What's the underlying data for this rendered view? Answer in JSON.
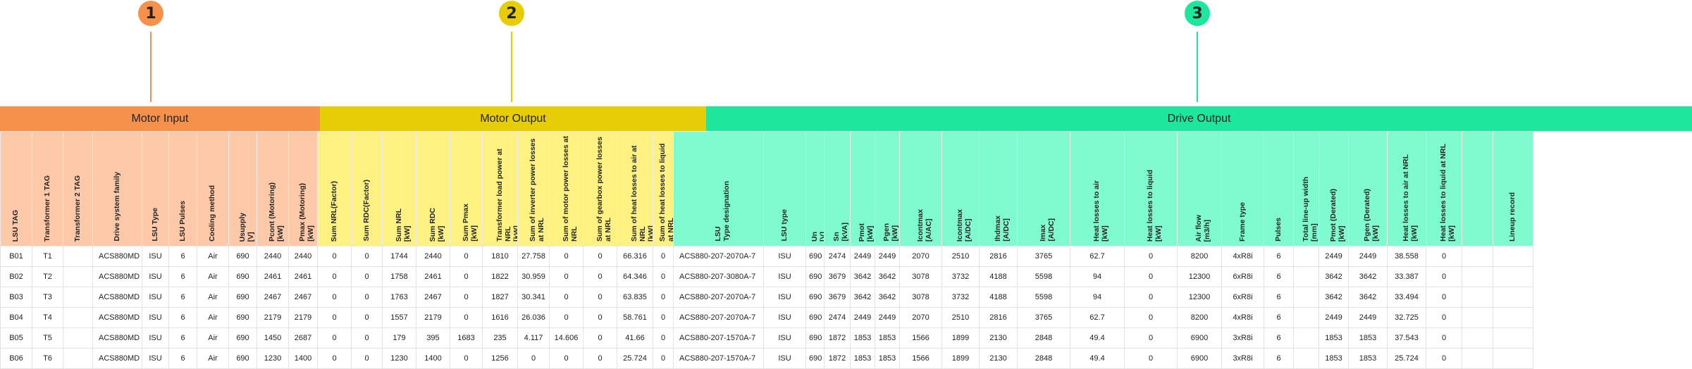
{
  "colors": {
    "motor_input_header": "#f5914a",
    "motor_input_columns": "#fdc9a8",
    "motor_output_header": "#e7cd05",
    "motor_output_columns": "#fdf281",
    "drive_output_header": "#1ee69c",
    "drive_output_columns": "#7efccf"
  },
  "callouts": [
    {
      "label": "1",
      "color": "#f5914a"
    },
    {
      "label": "2",
      "color": "#e7cd05"
    },
    {
      "label": "3",
      "color": "#1ee69c"
    }
  ],
  "sections": {
    "motor_input": "Motor Input",
    "motor_output": "Motor Output",
    "drive_output": "Drive Output"
  },
  "columns": [
    "LSU TAG",
    "Transformer 1 TAG",
    "Transformer 2 TAG",
    "Drive system family",
    "LSU Type",
    "LSU Pulses",
    "Cooling method",
    "Usupply\n[V]",
    "Pcont (Motoring)\n[kW]",
    "Pmax (Motoring)\n[kW]",
    "Sum NRL(Factor)",
    "Sum RDC(Factor)",
    "Sum NRL\n[kW]",
    "Sum RDC\n[kW]",
    "Sum Pmax\n[kW]",
    "Transformer load power at NRL\n[kW]",
    "Sum of inverter power losses at NRL",
    "Sum of motor power losses at NRL",
    "Sum of gearbox power losses at NRL",
    "Sum of heat losses to air at NRL\n[kW]",
    "Sum of heat losses to liquid at NRL",
    "LSU\nType designation",
    "LSU type",
    "Un\n[V]",
    "Sn\n[kVA]",
    "Pmot\n[kW]",
    "Pgen\n[kW]",
    "Icontmax\n[A/AC]",
    "Icontmax\n[A/DC]",
    "Ihdmax\n[A/DC]",
    "Imax\n[A/DC]",
    "Heat losses to air\n[kW]",
    "Heat losses to liquid\n[kW]",
    "Air flow\n[m3/h]",
    "Frame type",
    "Pulses",
    "Total line-up width\n[mm]",
    "Pmot (Derated)\n[kW]",
    "Pgen (Derated)\n[kW]",
    "Heat losses to air at NRL\n[kW]",
    "Heat losses to liquid at NRL\n[kW]",
    "",
    "Lineup record"
  ],
  "rows": [
    [
      "B01",
      "T1",
      "",
      "ACS880MD",
      "ISU",
      "6",
      "Air",
      "690",
      "2440",
      "2440",
      "0",
      "0",
      "1744",
      "2440",
      "0",
      "1810",
      "27.758",
      "0",
      "0",
      "66.316",
      "0",
      "ACS880-207-2070A-7",
      "ISU",
      "690",
      "2474",
      "2449",
      "2449",
      "2070",
      "2510",
      "2816",
      "3765",
      "62.7",
      "0",
      "8200",
      "4xR8i",
      "6",
      "",
      "2449",
      "2449",
      "38.558",
      "0",
      "",
      ""
    ],
    [
      "B02",
      "T2",
      "",
      "ACS880MD",
      "ISU",
      "6",
      "Air",
      "690",
      "2461",
      "2461",
      "0",
      "0",
      "1758",
      "2461",
      "0",
      "1822",
      "30.959",
      "0",
      "0",
      "64.346",
      "0",
      "ACS880-207-3080A-7",
      "ISU",
      "690",
      "3679",
      "3642",
      "3642",
      "3078",
      "3732",
      "4188",
      "5598",
      "94",
      "0",
      "12300",
      "6xR8i",
      "6",
      "",
      "3642",
      "3642",
      "33.387",
      "0",
      "",
      ""
    ],
    [
      "B03",
      "T3",
      "",
      "ACS880MD",
      "ISU",
      "6",
      "Air",
      "690",
      "2467",
      "2467",
      "0",
      "0",
      "1763",
      "2467",
      "0",
      "1827",
      "30.341",
      "0",
      "0",
      "63.835",
      "0",
      "ACS880-207-2070A-7",
      "ISU",
      "690",
      "3679",
      "3642",
      "3642",
      "3078",
      "3732",
      "4188",
      "5598",
      "94",
      "0",
      "12300",
      "6xR8i",
      "6",
      "",
      "3642",
      "3642",
      "33.494",
      "0",
      "",
      ""
    ],
    [
      "B04",
      "T4",
      "",
      "ACS880MD",
      "ISU",
      "6",
      "Air",
      "690",
      "2179",
      "2179",
      "0",
      "0",
      "1557",
      "2179",
      "0",
      "1616",
      "26.036",
      "0",
      "0",
      "58.761",
      "0",
      "ACS880-207-2070A-7",
      "ISU",
      "690",
      "2474",
      "2449",
      "2449",
      "2070",
      "2510",
      "2816",
      "3765",
      "62.7",
      "0",
      "8200",
      "4xR8i",
      "6",
      "",
      "2449",
      "2449",
      "32.725",
      "0",
      "",
      ""
    ],
    [
      "B05",
      "T5",
      "",
      "ACS880MD",
      "ISU",
      "6",
      "Air",
      "690",
      "1450",
      "2687",
      "0",
      "0",
      "179",
      "395",
      "1683",
      "235",
      "4.117",
      "14.606",
      "0",
      "41.66",
      "0",
      "ACS880-207-1570A-7",
      "ISU",
      "690",
      "1872",
      "1853",
      "1853",
      "1566",
      "1899",
      "2130",
      "2848",
      "49.4",
      "0",
      "6900",
      "3xR8i",
      "6",
      "",
      "1853",
      "1853",
      "37.543",
      "0",
      "",
      ""
    ],
    [
      "B06",
      "T6",
      "",
      "ACS880MD",
      "ISU",
      "6",
      "Air",
      "690",
      "1230",
      "1400",
      "0",
      "0",
      "1230",
      "1400",
      "0",
      "1256",
      "0",
      "0",
      "0",
      "25.724",
      "0",
      "ACS880-207-1570A-7",
      "ISU",
      "690",
      "1872",
      "1853",
      "1853",
      "1566",
      "1899",
      "2130",
      "2848",
      "49.4",
      "0",
      "6900",
      "3xR8i",
      "6",
      "",
      "1853",
      "1853",
      "25.724",
      "0",
      "",
      ""
    ]
  ]
}
